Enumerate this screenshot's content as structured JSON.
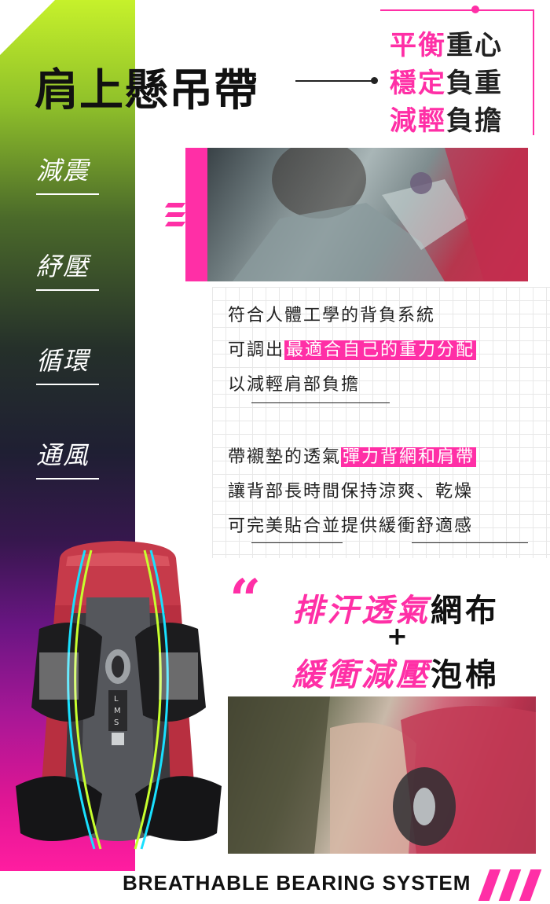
{
  "header": {
    "title": "肩上懸吊帶",
    "slogans": [
      {
        "pink": "平衡",
        "dark": "重心"
      },
      {
        "pink": "穩定",
        "dark": "負重"
      },
      {
        "pink": "減輕",
        "dark": "負擔"
      }
    ]
  },
  "features": [
    "減震",
    "紓壓",
    "循環",
    "通風"
  ],
  "description": {
    "para1_line1": "符合人體工學的背負系統",
    "para1_line2_pre": "可調出",
    "para1_line2_hl": "最適合自己的重力分配",
    "para1_line3": "以減輕肩部負擔",
    "para2_line1_pre": "帶襯墊的透氣",
    "para2_line1_hl": "彈力背網和肩帶",
    "para2_line2": "讓背部長時間保持涼爽、乾燥",
    "para2_line3": "可完美貼合並提供緩衝舒適感"
  },
  "highlight": {
    "quote": "“",
    "line1_pink": "排汗透氣",
    "line1_dark": "網布",
    "plus": "+",
    "line2_pink": "緩衝減壓",
    "line2_dark": "泡棉"
  },
  "pack_sizes": [
    "L",
    "M",
    "S"
  ],
  "footer": {
    "text": "BREATHABLE BEARING SYSTEM"
  },
  "colors": {
    "accent": "#ff2fa6",
    "lime": "#c6f12b",
    "purple": "#6a1583"
  }
}
